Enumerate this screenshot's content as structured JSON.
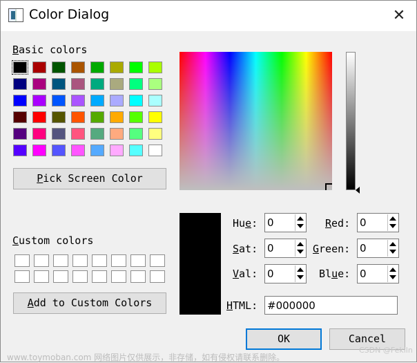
{
  "window": {
    "title": "Color Dialog",
    "close_glyph": "✕"
  },
  "basic": {
    "label": "Basic colors",
    "colors": [
      "#000000",
      "#aa0000",
      "#005500",
      "#aa5500",
      "#00aa00",
      "#aaaa00",
      "#00ff00",
      "#aaff00",
      "#00007f",
      "#aa007f",
      "#00557f",
      "#aa557f",
      "#00aa7f",
      "#aaaa7f",
      "#00ff7f",
      "#aaff7f",
      "#0000ff",
      "#aa00ff",
      "#0055ff",
      "#aa55ff",
      "#00aaff",
      "#aaaaff",
      "#00ffff",
      "#aaffff",
      "#550000",
      "#ff0000",
      "#555500",
      "#ff5500",
      "#55aa00",
      "#ffaa00",
      "#55ff00",
      "#ffff00",
      "#55007f",
      "#ff007f",
      "#55557f",
      "#ff557f",
      "#55aa7f",
      "#ffaa7f",
      "#55ff7f",
      "#ffff7f",
      "#5500ff",
      "#ff00ff",
      "#5555ff",
      "#ff55ff",
      "#55aaff",
      "#ffaaff",
      "#55ffff",
      "#ffffff"
    ]
  },
  "pick_screen_label": "Pick Screen Color",
  "custom": {
    "label": "Custom colors",
    "count": 16
  },
  "add_custom_label": "Add to Custom Colors",
  "fields": {
    "hue": {
      "label": "Hue:",
      "value": "0"
    },
    "sat": {
      "label": "Sat:",
      "value": "0"
    },
    "val": {
      "label": "Val:",
      "value": "0"
    },
    "red": {
      "label": "Red:",
      "value": "0"
    },
    "green": {
      "label": "Green:",
      "value": "0"
    },
    "blue": {
      "label": "Blue:",
      "value": "0"
    },
    "html": {
      "label": "HTML:",
      "value": "#000000"
    }
  },
  "current_color": "#000000",
  "ok_label": "OK",
  "cancel_label": "Cancel",
  "watermark": "www.toymoban.com 网络图片仅供展示，非存储，如有侵权请联系删除。",
  "watermark2": "CSDN @Fekiln"
}
